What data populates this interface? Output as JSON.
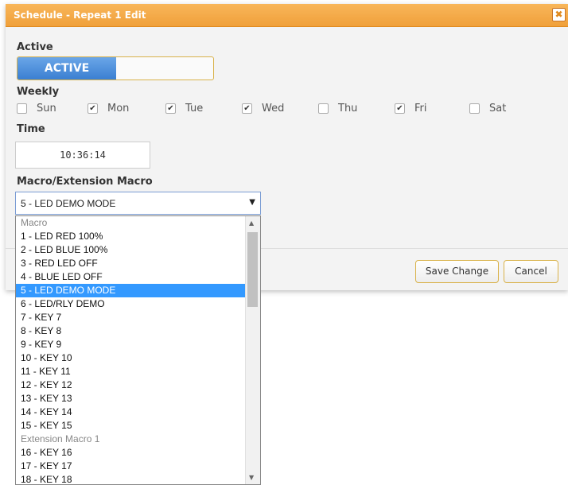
{
  "dialog": {
    "title": "Schedule - Repeat 1 Edit",
    "close_icon": "close-icon",
    "close_glyph": "✖"
  },
  "active": {
    "label": "Active",
    "toggle_on_label": "ACTIVE"
  },
  "weekly": {
    "label": "Weekly",
    "days": [
      {
        "name": "Sun",
        "checked": false
      },
      {
        "name": "Mon",
        "checked": true
      },
      {
        "name": "Tue",
        "checked": true
      },
      {
        "name": "Wed",
        "checked": true
      },
      {
        "name": "Thu",
        "checked": false
      },
      {
        "name": "Fri",
        "checked": true
      },
      {
        "name": "Sat",
        "checked": false
      }
    ]
  },
  "time": {
    "label": "Time",
    "value": "10:36:14"
  },
  "macro": {
    "label": "Macro/Extension Macro",
    "selected": "5 - LED DEMO MODE",
    "options": [
      {
        "text": "Macro",
        "group": true
      },
      {
        "text": "1 - LED RED 100%"
      },
      {
        "text": "2 - LED BLUE 100%"
      },
      {
        "text": "3 - RED LED OFF"
      },
      {
        "text": "4 - BLUE LED OFF"
      },
      {
        "text": "5 - LED DEMO MODE",
        "selected": true
      },
      {
        "text": "6 - LED/RLY DEMO"
      },
      {
        "text": "7 - KEY 7"
      },
      {
        "text": "8 - KEY 8"
      },
      {
        "text": "9 - KEY 9"
      },
      {
        "text": "10 - KEY 10"
      },
      {
        "text": "11 - KEY 11"
      },
      {
        "text": "12 - KEY 12"
      },
      {
        "text": "13 - KEY 13"
      },
      {
        "text": "14 - KEY 14"
      },
      {
        "text": "15 - KEY 15"
      },
      {
        "text": "Extension Macro 1",
        "group": true
      },
      {
        "text": "16 - KEY 16"
      },
      {
        "text": "17 - KEY 17"
      },
      {
        "text": "18 - KEY 18"
      }
    ]
  },
  "buttons": {
    "save_label": "Save Change",
    "cancel_label": "Cancel"
  },
  "colors": {
    "title_bar": "#f0a03a",
    "toggle_active": "#3b7fd1",
    "selected_option": "#3399ff"
  }
}
